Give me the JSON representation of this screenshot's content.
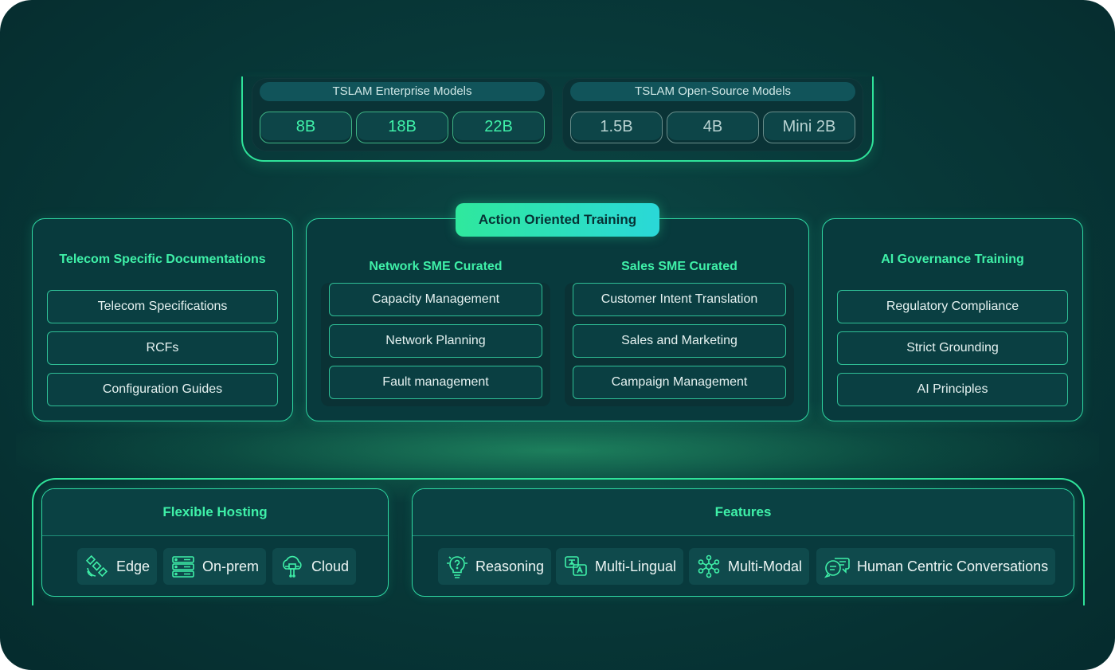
{
  "models": {
    "enterprise": {
      "title": "TSLAM Enterprise Models",
      "sizes": [
        "8B",
        "18B",
        "22B"
      ]
    },
    "open_source": {
      "title": "TSLAM Open-Source Models",
      "sizes": [
        "1.5B",
        "4B",
        "Mini 2B"
      ]
    }
  },
  "telecom_docs": {
    "title": "Telecom Specific Documentations",
    "items": [
      "Telecom Specifications",
      "RCFs",
      "Configuration Guides"
    ]
  },
  "action_training": {
    "title": "Action Oriented Training",
    "network": {
      "title": "Network SME Curated",
      "items": [
        "Capacity Management",
        "Network Planning",
        "Fault management"
      ]
    },
    "sales": {
      "title": "Sales SME Curated",
      "items": [
        "Customer Intent Translation",
        "Sales and Marketing",
        "Campaign Management"
      ]
    }
  },
  "ai_governance": {
    "title": "AI Governance Training",
    "items": [
      "Regulatory Compliance",
      "Strict Grounding",
      "AI Principles"
    ]
  },
  "hosting": {
    "title": "Flexible Hosting",
    "options": [
      {
        "label": "Edge",
        "icon": "satellite-icon"
      },
      {
        "label": "On-prem",
        "icon": "server-rack-icon"
      },
      {
        "label": "Cloud",
        "icon": "cloud-circuit-icon"
      }
    ]
  },
  "features": {
    "title": "Features",
    "items": [
      {
        "label": "Reasoning",
        "icon": "lightbulb-question-icon"
      },
      {
        "label": "Multi-Lingual",
        "icon": "translate-icon"
      },
      {
        "label": "Multi-Modal",
        "icon": "network-nodes-icon"
      },
      {
        "label": "Human Centric Conversations",
        "icon": "chat-bubbles-icon"
      }
    ]
  },
  "colors": {
    "accent": "#3ff0a8",
    "background": "#083a3a",
    "border": "#2fd9a3"
  }
}
